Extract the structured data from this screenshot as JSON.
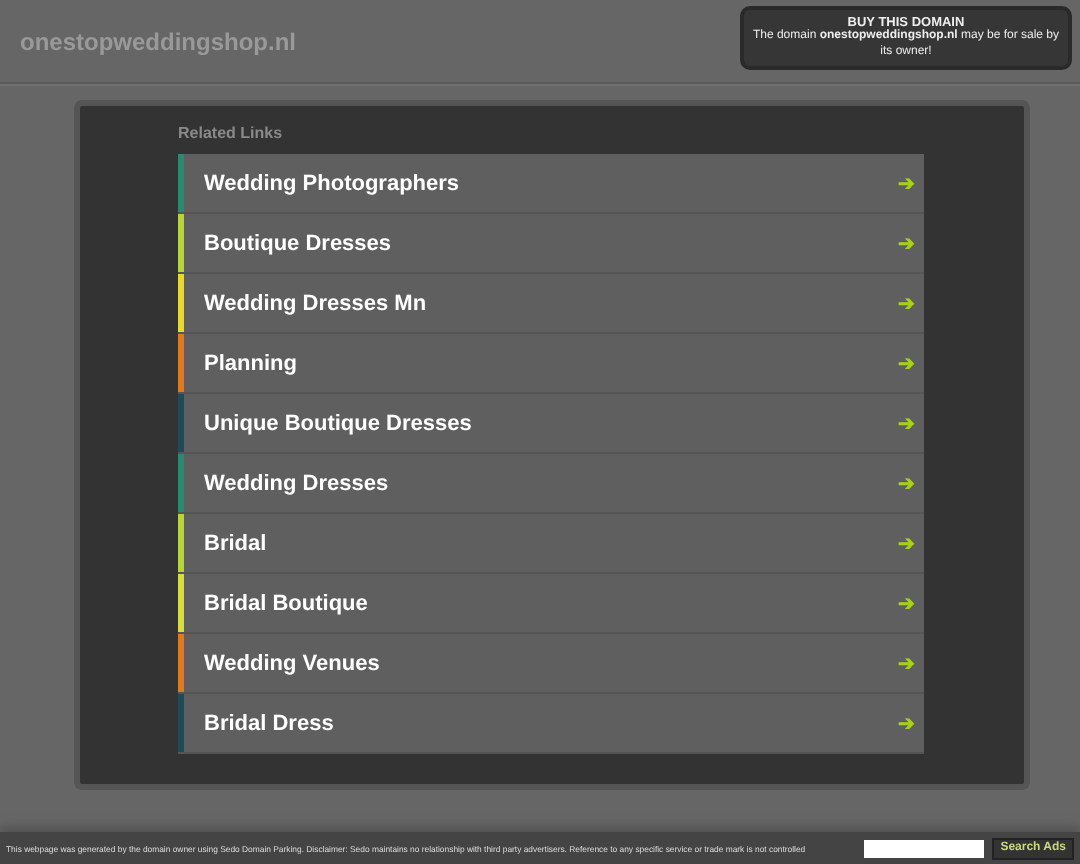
{
  "header": {
    "site_name": "onestopweddingshop.nl",
    "promo": {
      "title": "BUY THIS DOMAIN",
      "text": "The domain **onestopweddingshop.nl** may be for sale by its owner!"
    }
  },
  "related": {
    "heading": "Related Links",
    "links": [
      {
        "label": "Wedding Photographers",
        "color": "#2a8a70",
        "arrow": "➔"
      },
      {
        "label": "Boutique Dresses",
        "color": "#b8d43a",
        "arrow": "➔"
      },
      {
        "label": "Wedding Dresses Mn",
        "color": "#e8d830",
        "arrow": "➔"
      },
      {
        "label": "Planning",
        "color": "#e07a1e",
        "arrow": "➔"
      },
      {
        "label": "Unique Boutique Dresses",
        "color": "#1e4a5a",
        "arrow": "➔"
      },
      {
        "label": "Wedding Dresses",
        "color": "#2a8a70",
        "arrow": "➔"
      },
      {
        "label": "Bridal",
        "color": "#b8d43a",
        "arrow": "➔"
      },
      {
        "label": "Bridal Boutique",
        "color": "#d8dc40",
        "arrow": "➔"
      },
      {
        "label": "Wedding Venues",
        "color": "#e07a1e",
        "arrow": "➔"
      },
      {
        "label": "Bridal Dress",
        "color": "#1e4a5a",
        "arrow": "➔"
      }
    ]
  },
  "footer": {
    "disclaimer": "This webpage was generated by the domain owner using Sedo Domain Parking. Disclaimer: Sedo maintains no relationship with third party advertisers. Reference to any specific service or trade mark is not controlled",
    "search_button": "Search Ads"
  }
}
